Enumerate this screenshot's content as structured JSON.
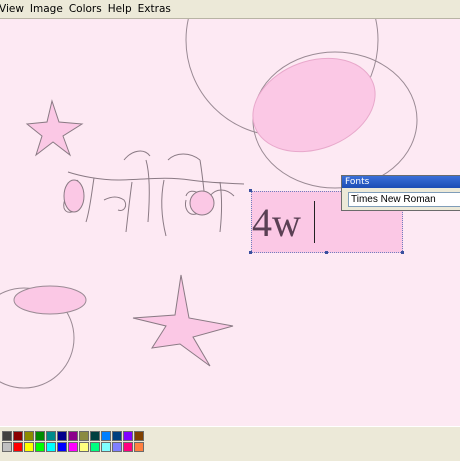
{
  "menubar": {
    "items": [
      {
        "label": "View"
      },
      {
        "label": "Image"
      },
      {
        "label": "Colors"
      },
      {
        "label": "Help"
      },
      {
        "label": "Extras"
      }
    ]
  },
  "font_dialog": {
    "title": "Fonts",
    "selected_font": "Times New Roman"
  },
  "text_tool": {
    "text": "4w"
  },
  "palette": {
    "row1": [
      "#404040",
      "#8b0000",
      "#8b8b00",
      "#008b00",
      "#008b8b",
      "#00008b",
      "#8b008b",
      "#8b8b40",
      "#004040",
      "#0080ff",
      "#004080",
      "#8000ff",
      "#804000"
    ],
    "row2": [
      "#c0c0c0",
      "#ff0000",
      "#ffff00",
      "#00ff00",
      "#00ffff",
      "#0000ff",
      "#ff00ff",
      "#ffff80",
      "#00ff80",
      "#80ffff",
      "#8080ff",
      "#ff0080",
      "#ff8040"
    ]
  }
}
